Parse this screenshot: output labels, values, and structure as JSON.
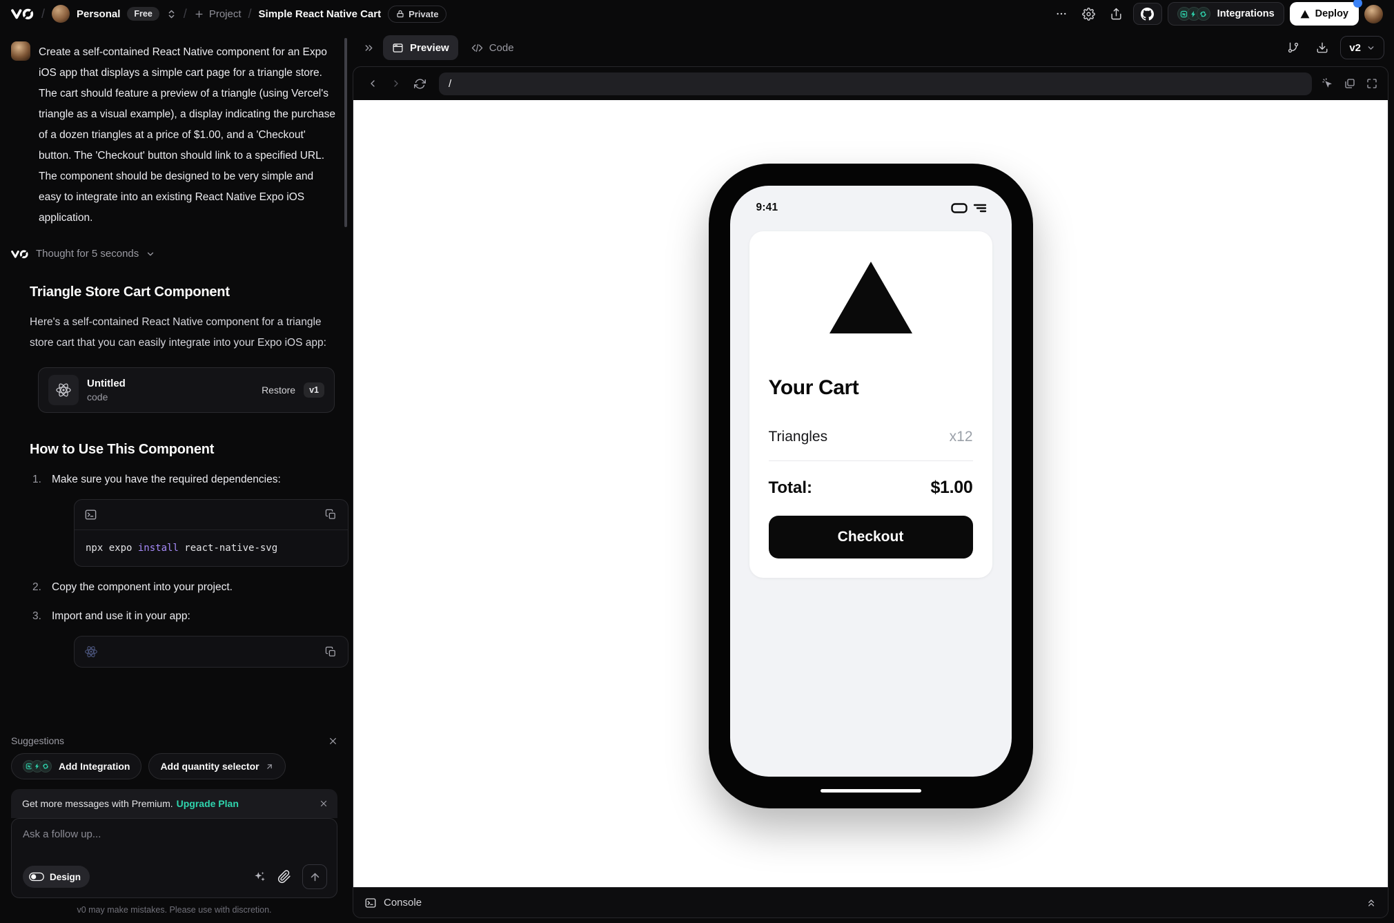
{
  "topbar": {
    "team_name": "Personal",
    "plan_badge": "Free",
    "project_button": "Project",
    "chat_title": "Simple React Native Cart",
    "privacy_badge": "Private",
    "integrations_button": "Integrations",
    "deploy_button": "Deploy"
  },
  "chat": {
    "user_message": "Create a self-contained React Native component for an Expo iOS app that displays a simple cart page for a triangle store. The cart should feature a preview of a triangle (using Vercel's triangle as a visual example), a display indicating the purchase of a dozen triangles at a price of $1.00, and a 'Checkout' button. The 'Checkout' button should link to a specified URL. The component should be designed to be very simple and easy to integrate into an existing React Native Expo iOS application.",
    "thought_toggle": "Thought for 5 seconds",
    "response_heading": "Triangle Store Cart Component",
    "response_intro": "Here's a self-contained React Native component for a triangle store cart that you can easily integrate into your Expo iOS app:",
    "code_card": {
      "title": "Untitled",
      "subtitle": "code",
      "restore_button": "Restore",
      "version_badge": "v1"
    },
    "howto_heading": "How to Use This Component",
    "steps": [
      "Make sure you have the required dependencies:",
      "Copy the component into your project.",
      "Import and use it in your app:"
    ],
    "install_command": {
      "prefix": "npx expo ",
      "keyword": "install",
      "suffix": " react-native-svg"
    }
  },
  "suggestions": {
    "label": "Suggestions",
    "items": [
      "Add Integration",
      "Add quantity selector"
    ]
  },
  "premium_banner": {
    "message": "Get more messages with Premium.",
    "link": "Upgrade Plan"
  },
  "composer": {
    "placeholder": "Ask a follow up...",
    "design_toggle": "Design"
  },
  "disclaimer": "v0 may make mistakes. Please use with discretion.",
  "preview_panel": {
    "preview_tab": "Preview",
    "code_tab": "Code",
    "version_selector": "v2",
    "url_value": "/",
    "console_label": "Console"
  },
  "phone": {
    "status_time": "9:41",
    "cart": {
      "heading": "Your Cart",
      "item_name": "Triangles",
      "item_qty": "x12",
      "total_label": "Total:",
      "total_value": "$1.00",
      "checkout_button": "Checkout"
    }
  },
  "colors": {
    "keyword_purple": "#a78bfa",
    "accent_teal": "#2fd4ad",
    "notification_blue": "#3b82f6"
  }
}
